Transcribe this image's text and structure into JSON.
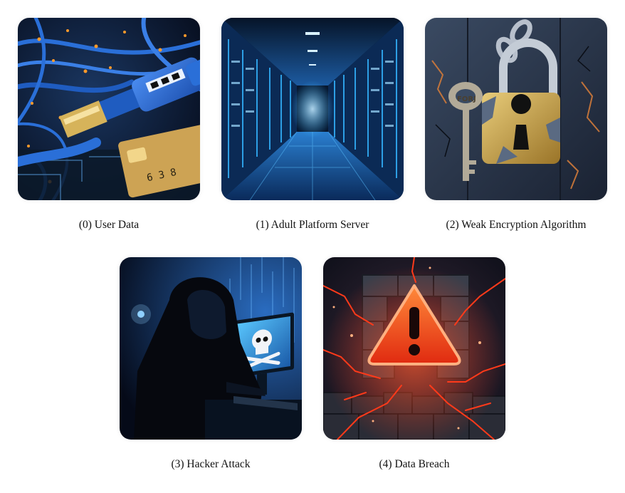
{
  "panels": [
    {
      "index": 0,
      "caption": "(0) User Data",
      "subject": "usb-cable-and-credit-card"
    },
    {
      "index": 1,
      "caption": "(1) Adult Platform Server",
      "subject": "server-room-corridor"
    },
    {
      "index": 2,
      "caption": "(2) Weak Encryption Algorithm",
      "subject": "broken-padlock-with-key"
    },
    {
      "index": 3,
      "caption": "(3) Hacker Attack",
      "subject": "hooded-hacker-at-computer"
    },
    {
      "index": 4,
      "caption": "(4) Data Breach",
      "subject": "warning-sign-on-cracked-wall"
    }
  ],
  "key_label": "FORJ",
  "card_digits": "6 3 8",
  "colors": {
    "cable_blue": "#2a6fd8",
    "server_cyan": "#34b4ff",
    "lock_gold": "#c9a24a",
    "breach_red": "#ff3a1a"
  }
}
